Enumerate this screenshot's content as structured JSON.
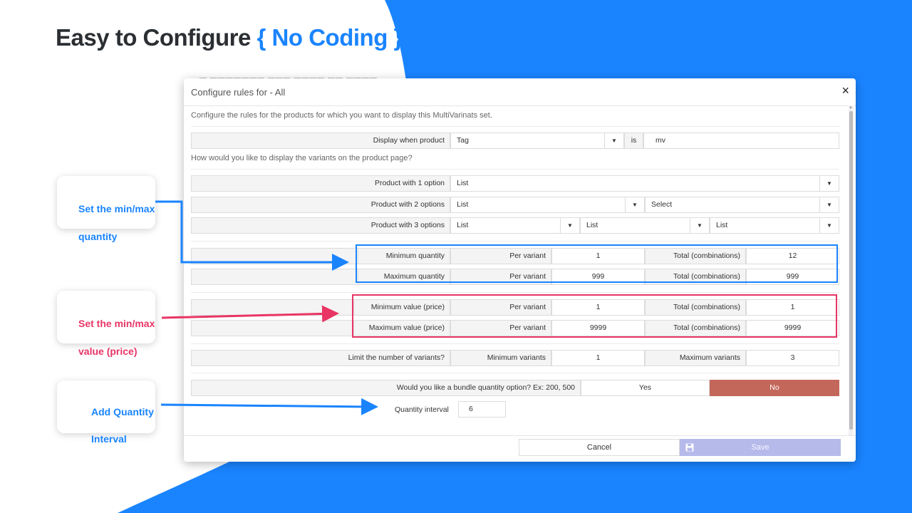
{
  "headline": {
    "text": "Easy to Configure ",
    "accent": "{ No Coding }"
  },
  "ghost_text": "▬ ▬▬▬▬▬▬▬      ▬▬▬ ▬▬▬▬      ▬▬ ▬▬▬▬",
  "callouts": {
    "minmax_quantity": {
      "line1": "Set the min/max",
      "line2": "quantity"
    },
    "minmax_value": {
      "line1": "Set the min/max",
      "line2": "value (price)"
    },
    "quantity_interval": {
      "line1": "Add Quantity",
      "line2": "Interval"
    }
  },
  "modal": {
    "title": "Configure rules for - All",
    "close_icon": "×",
    "description": "Configure the rules for the products for which you want to display this MultiVarinats set.",
    "display_when": {
      "label": "Display when product",
      "select": "Tag",
      "operator": "is",
      "value": "mv"
    },
    "display_question": "How would you like to display the variants on the product page?",
    "options": [
      {
        "label": "Product with 1 option",
        "selects": [
          "List"
        ]
      },
      {
        "label": "Product with 2 options",
        "selects": [
          "List",
          "Select"
        ]
      },
      {
        "label": "Product with 3 options",
        "selects": [
          "List",
          "List",
          "List"
        ]
      }
    ],
    "min_quantity": {
      "label": "Minimum quantity",
      "per_label": "Per variant",
      "per_value": "1",
      "total_label": "Total (combinations)",
      "total_value": "12"
    },
    "max_quantity": {
      "label": "Maximum quantity",
      "per_label": "Per variant",
      "per_value": "999",
      "total_label": "Total (combinations)",
      "total_value": "999"
    },
    "min_value": {
      "label": "Minimum value (price)",
      "per_label": "Per variant",
      "per_value": "1",
      "total_label": "Total (combinations)",
      "total_value": "1"
    },
    "max_value": {
      "label": "Maximum value (price)",
      "per_label": "Per variant",
      "per_value": "9999",
      "total_label": "Total (combinations)",
      "total_value": "9999"
    },
    "limit_variants": {
      "label": "Limit the number of variants?",
      "min_label": "Minimum variants",
      "min_value": "1",
      "max_label": "Maximum variants",
      "max_value": "3"
    },
    "bundle": {
      "question": "Would you like a bundle quantity option? Ex: 200, 500",
      "yes": "Yes",
      "no": "No"
    },
    "quantity_interval": {
      "label": "Quantity interval",
      "value": "6"
    },
    "footer": {
      "cancel": "Cancel",
      "save": "Save"
    }
  },
  "colors": {
    "brand_blue": "#1a84ff",
    "highlight_red": "#e83565",
    "no_button": "#c4675b",
    "save_button": "#b6baea"
  },
  "icons": {
    "close": "close-icon",
    "caret": "caret-down-icon",
    "save": "floppy-disk-icon"
  }
}
